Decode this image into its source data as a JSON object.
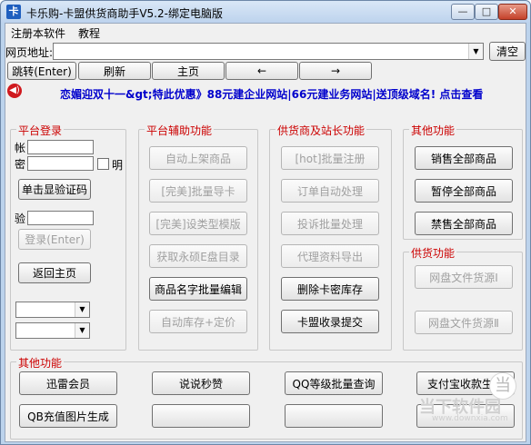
{
  "window": {
    "title": "卡乐购-卡盟供货商助手V5.2-绑定电脑版",
    "app_icon_glyph": "卡",
    "minimize_glyph": "—",
    "maximize_glyph": "□",
    "close_glyph": "✕"
  },
  "menu": {
    "items": [
      "注册本软件",
      "教程"
    ]
  },
  "address": {
    "label": "网页地址:",
    "value": "",
    "dropdown_glyph": "▼",
    "clear_button": "清空"
  },
  "nav": {
    "goto_button": "跳转(Enter)",
    "refresh_button": "刷新",
    "home_button": "主页",
    "back_button": "←",
    "forward_button": "→"
  },
  "notice": {
    "speaker_glyph": "◀)",
    "text": "恋媚迎双十一&gt;特此优惠》88元建企业网站|66元建业务网站|送顶级域名! 点击查看"
  },
  "login": {
    "group_title": "平台登录",
    "account_label": "帐",
    "password_label": "密",
    "show_label": "明",
    "captcha_button": "单击显验证码",
    "verify_label": "验",
    "login_button": "登录(Enter)",
    "return_home_button": "返回主页",
    "select1_arrow": "▼",
    "select2_arrow": "▼"
  },
  "assist": {
    "group_title": "平台辅助功能",
    "buttons": [
      "自动上架商品",
      "[完美]批量导卡",
      "[完美]设类型模版",
      "获取永硕E盘目录",
      "商品名字批量编辑",
      "自动库存+定价"
    ]
  },
  "supplier": {
    "group_title": "供货商及站长功能",
    "buttons": [
      "[hot]批量注册",
      "订单自动处理",
      "投诉批量处理",
      "代理资料导出",
      "删除卡密库存",
      "卡盟收录提交"
    ]
  },
  "other_top": {
    "group_title": "其他功能",
    "buttons": [
      "销售全部商品",
      "暂停全部商品",
      "禁售全部商品"
    ]
  },
  "supply": {
    "group_title": "供货功能",
    "buttons": [
      "网盘文件货源Ⅰ",
      "网盘文件货源Ⅱ"
    ]
  },
  "other_bottom": {
    "group_title": "其他功能",
    "buttons": [
      "迅雷会员",
      "说说秒赞",
      "QQ等级批量查询",
      "支付宝收款生成",
      "QB充值图片生成",
      "",
      "",
      ""
    ]
  },
  "watermark": {
    "logo_glyph": "当",
    "text": "当下软件园",
    "sub": "www.downxia.com"
  }
}
